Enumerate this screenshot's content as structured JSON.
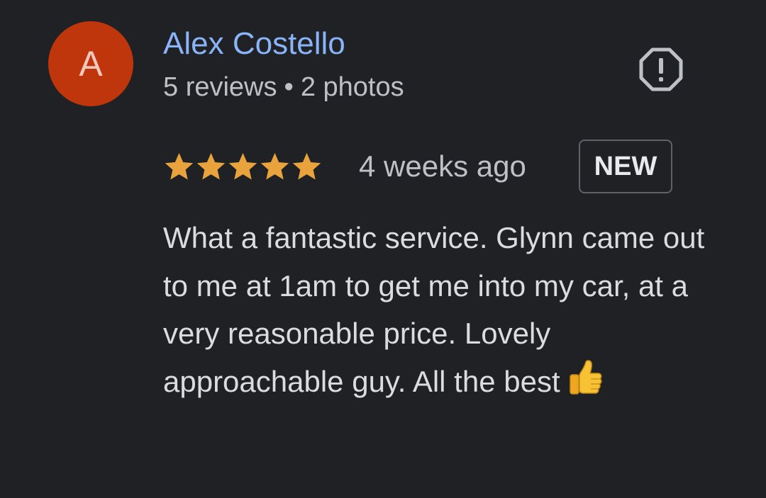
{
  "review": {
    "author": {
      "initial": "A",
      "name": "Alex Costello",
      "review_count": "5 reviews",
      "separator": "•",
      "photo_count": "2 photos",
      "avatar_color": "#bf360c"
    },
    "report_icon": "report-flag-icon",
    "rating": {
      "stars": 5,
      "max": 5,
      "star_color": "#e8a33d"
    },
    "date": "4 weeks ago",
    "badge": "NEW",
    "text": "What a fantastic service. Glynn came out to me at 1am to get me into my car, at a very reasonable price. Lovely approachable guy. All the best",
    "text_emoji": "thumbs-up-icon",
    "colors": {
      "background": "#202124",
      "name": "#8ab4f8",
      "secondary_text": "#bdc1c6",
      "body_text": "#dadce0"
    }
  }
}
